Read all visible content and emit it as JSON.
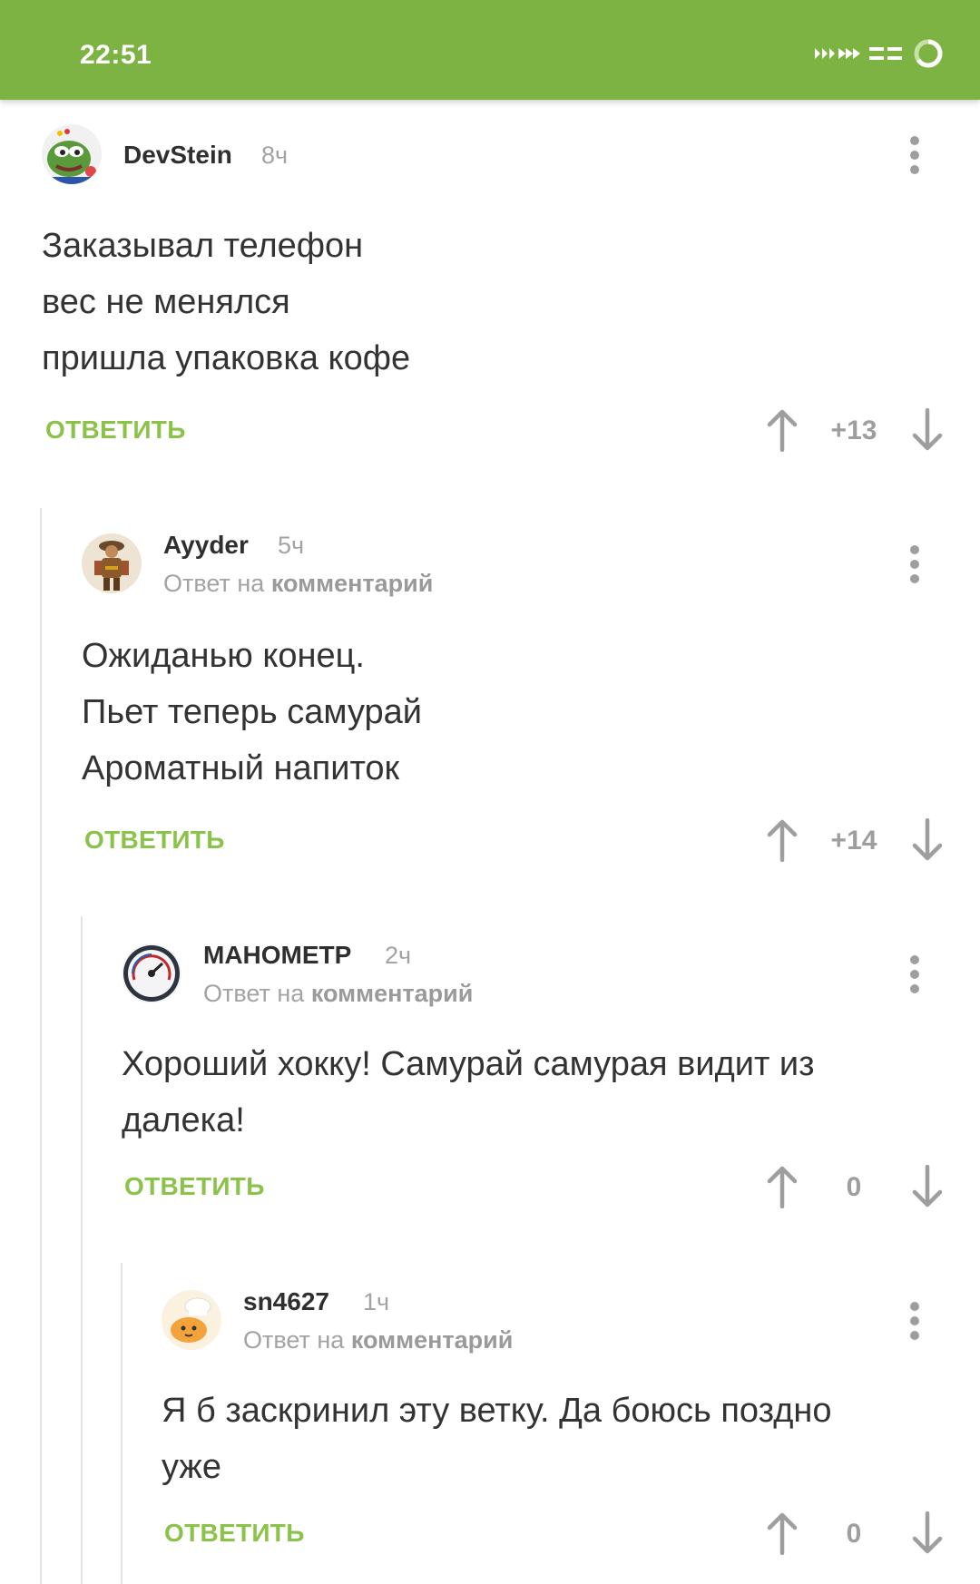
{
  "status_bar": {
    "time": "22:51"
  },
  "comments": [
    {
      "author": "DevStein",
      "time": "8ч",
      "reply_prefix": "",
      "reply_link": "",
      "lines": [
        "Заказывал телефон",
        "вес не менялся",
        "пришла упаковка кофе"
      ],
      "reply_label": "ОТВЕТИТЬ",
      "rating": "+13",
      "avatar_icon": "pepe-frog-avatar"
    },
    {
      "author": "Ayyder",
      "time": "5ч",
      "reply_prefix": "Ответ на",
      "reply_link": "комментарий",
      "lines": [
        "Ожиданью конец.",
        "Пьет теперь самурай",
        "Ароматный напиток"
      ],
      "reply_label": "ОТВЕТИТЬ",
      "rating": "+14",
      "avatar_icon": "samurai-figure-avatar"
    },
    {
      "author": "МАНОМЕТР",
      "time": "2ч",
      "reply_prefix": "Ответ на",
      "reply_link": "комментарий",
      "lines": [
        "Хороший хокку!   Самурай самурая видит из",
        "далека!"
      ],
      "reply_label": "ОТВЕТИТЬ",
      "rating": "0",
      "avatar_icon": "pressure-gauge-avatar"
    },
    {
      "author": "sn4627",
      "time": "1ч",
      "reply_prefix": "Ответ на",
      "reply_link": "комментарий",
      "lines": [
        "Я б заскринил эту ветку. Да боюсь поздно",
        "уже"
      ],
      "reply_label": "ОТВЕТИТЬ",
      "rating": "0",
      "avatar_icon": "chef-cat-avatar"
    }
  ],
  "colors": {
    "status_bar_bg": "#7cb342",
    "reply_button": "#8bc34a",
    "muted_text": "#a3a3a3"
  }
}
